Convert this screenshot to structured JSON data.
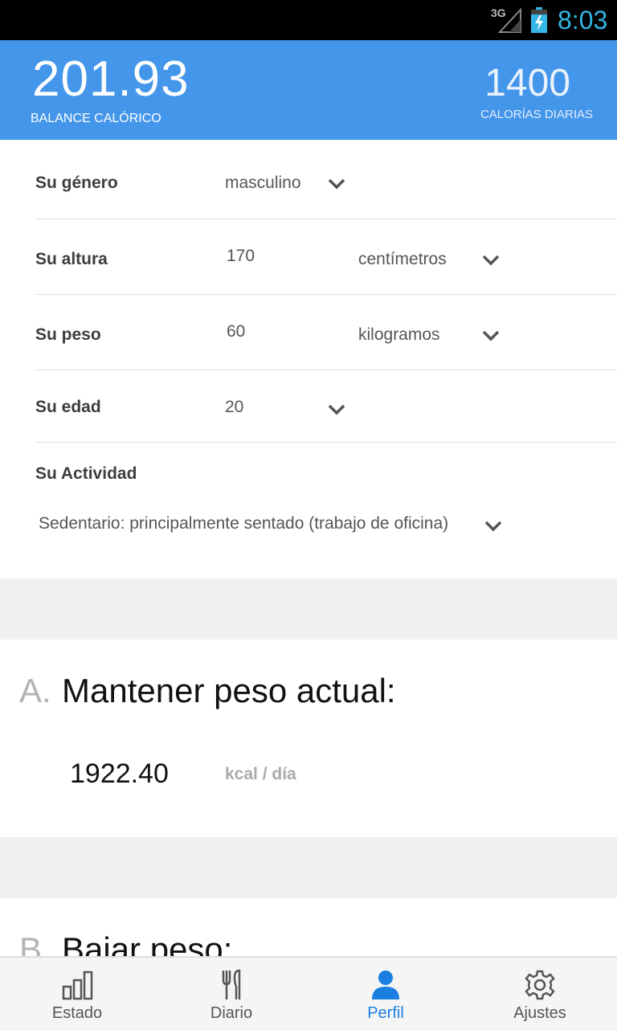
{
  "status_bar": {
    "network": "3G",
    "time": "8:03"
  },
  "header": {
    "balance_value": "201.93",
    "balance_label": "BALANCE CALÓRICO",
    "daily_value": "1400",
    "daily_label": "CALORÍAS DIARIAS"
  },
  "profile": {
    "gender": {
      "label": "Su género",
      "value": "masculino"
    },
    "height": {
      "label": "Su altura",
      "value": "170",
      "unit": "centímetros"
    },
    "weight": {
      "label": "Su peso",
      "value": "60",
      "unit": "kilogramos"
    },
    "age": {
      "label": "Su edad",
      "value": "20"
    },
    "activity": {
      "label": "Su Actividad",
      "value": "Sedentario: principalmente sentado (trabajo de oficina)"
    }
  },
  "plan_a": {
    "letter": "A.",
    "title": "Mantener peso actual:",
    "value": "1922.40",
    "unit": "kcal / día"
  },
  "plan_b": {
    "letter": "B.",
    "title": "Bajar peso:"
  },
  "nav": [
    {
      "label": "Estado",
      "icon": "bar-chart-icon",
      "active": false
    },
    {
      "label": "Diario",
      "icon": "fork-knife-icon",
      "active": false
    },
    {
      "label": "Perfil",
      "icon": "person-icon",
      "active": true
    },
    {
      "label": "Ajustes",
      "icon": "gear-icon",
      "active": false
    }
  ],
  "colors": {
    "accent": "#4396ea",
    "active_nav": "#1a7fe0",
    "status_time": "#33b5e5"
  }
}
